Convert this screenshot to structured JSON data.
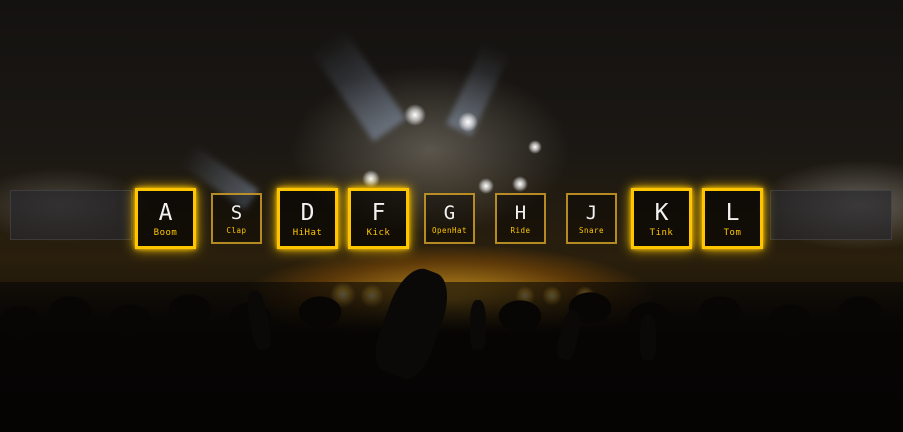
{
  "keys": [
    {
      "letter": "A",
      "sound": "Boom",
      "state": "playing"
    },
    {
      "letter": "S",
      "sound": "Clap",
      "state": "idle"
    },
    {
      "letter": "D",
      "sound": "HiHat",
      "state": "playing"
    },
    {
      "letter": "F",
      "sound": "Kick",
      "state": "playing"
    },
    {
      "letter": "G",
      "sound": "OpenHat",
      "state": "idle"
    },
    {
      "letter": "H",
      "sound": "Ride",
      "state": "idle"
    },
    {
      "letter": "J",
      "sound": "Snare",
      "state": "idle"
    },
    {
      "letter": "K",
      "sound": "Tink",
      "state": "playing"
    },
    {
      "letter": "L",
      "sound": "Tom",
      "state": "playing"
    }
  ],
  "colors": {
    "accent": "#ffc600",
    "key_text": "#ffffff"
  }
}
